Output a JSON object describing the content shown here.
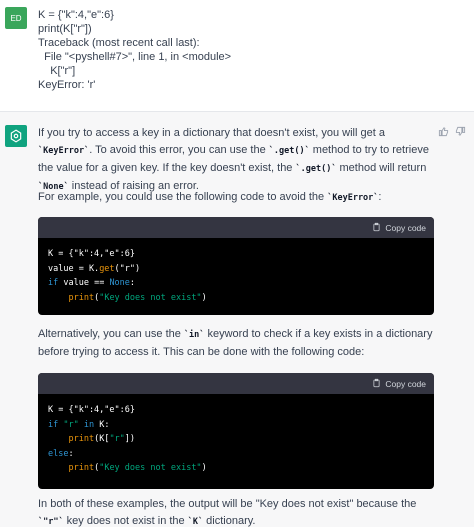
{
  "user": {
    "avatar": "ED",
    "lines": [
      "K = {\"k\":4,\"e\":6}",
      "print(K[\"r\"])",
      "Traceback (most recent call last):",
      "  File \"<pyshell#7>\", line 1, in <module>",
      "    K[\"r\"]",
      "KeyError: 'r'"
    ]
  },
  "assistant": {
    "p1_a": "If you try to access a key in a dictionary that doesn't exist, you will get a ",
    "p1_code1": "`KeyError`",
    "p1_b": ". To avoid this error, you can use the ",
    "p1_code2": "`.get()`",
    "p1_c": " method to try to retrieve the value for a given key. If the key doesn't exist, the ",
    "p1_code3": "`.get()`",
    "p1_d": " method will return ",
    "p1_code4": "`None`",
    "p1_e": " instead of raising an error.",
    "p2_a": "For example, you could use the following code to avoid the ",
    "p2_code": "`KeyError`",
    "p2_b": ":",
    "copy_label": "Copy code",
    "p3_a": "Alternatively, you can use the ",
    "p3_code": "`in`",
    "p3_b": " keyword to check if a key exists in a dictionary before trying to access it. This can be done with the following code:",
    "p4_a": "In both of these examples, the output will be \"Key does not exist\" because the ",
    "p4_code1": "`\"r\"`",
    "p4_b": " key does not exist in the ",
    "p4_code2": "`K`",
    "p4_c": " dictionary."
  },
  "code1": {
    "l1": "K = {\"k\":4,\"e\":6}",
    "l2_a": "value = K.",
    "l2_fn": "get",
    "l2_b": "(\"r\")",
    "l3_kw": "if",
    "l3_a": " value == ",
    "l3_none": "None",
    "l3_b": ":",
    "l4_fn": "print",
    "l4_a": "(",
    "l4_str": "\"Key does not exist\"",
    "l4_b": ")"
  },
  "code2": {
    "l1": "K = {\"k\":4,\"e\":6}",
    "l2_kw": "if",
    "l2_str": "\"r\"",
    "l2_in": "in",
    "l2_b": " K:",
    "l3_fn": "print",
    "l3_a": "(K[",
    "l3_str": "\"r\"",
    "l3_b": "])",
    "l4_kw": "else",
    "l4_b": ":",
    "l5_fn": "print",
    "l5_a": "(",
    "l5_str": "\"Key does not exist\"",
    "l5_b": ")"
  }
}
